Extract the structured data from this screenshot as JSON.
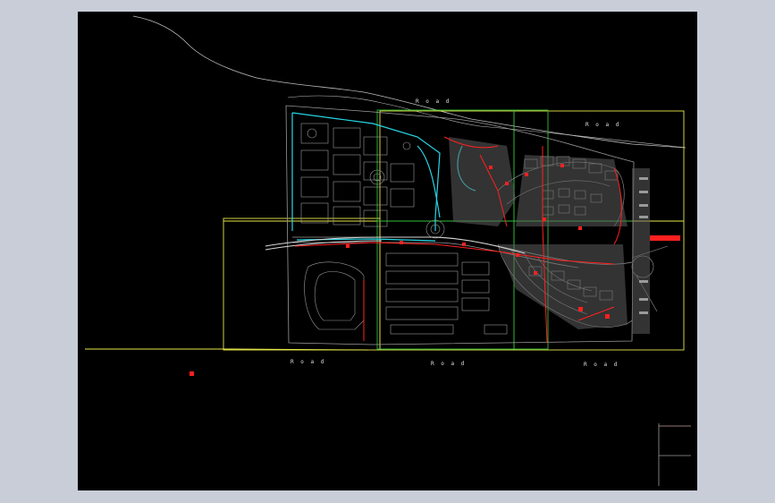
{
  "colors": {
    "frame": "#c8cdd8",
    "canvas": "#000000",
    "linework": "#9a9a9a",
    "boundary_cyan": "#27d7e6",
    "sheet_green": "#2fbf3a",
    "sheet_yellow": "#e8e84a",
    "utility_red": "#ff2020",
    "road_white": "#d8d8d8"
  },
  "labels": {
    "north_road": "R o a d",
    "north_road_east": "R o a d",
    "south_road_west": "R o a d",
    "south_road_mid": "R o a d",
    "south_road_east": "R o a d"
  },
  "icons": {
    "ucs": "crosshair-icon",
    "marker": "red-marker-icon"
  }
}
